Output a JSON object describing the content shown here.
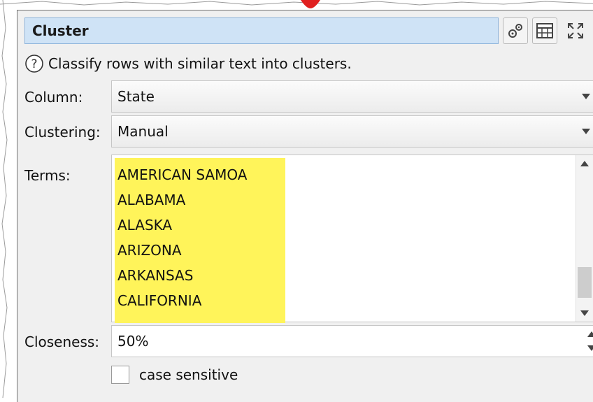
{
  "panel": {
    "title": "Cluster",
    "help_text": "Classify rows with similar text into clusters.",
    "icons": {
      "settings": "gears-icon",
      "table": "table-icon",
      "expand": "expand-icon",
      "help": "help-icon"
    }
  },
  "fields": {
    "column": {
      "label": "Column:",
      "value": "State"
    },
    "clustering": {
      "label": "Clustering:",
      "value": "Manual"
    },
    "terms": {
      "label": "Terms:",
      "items": [
        "AMERICAN SAMOA",
        "ALABAMA",
        "ALASKA",
        "ARIZONA",
        "ARKANSAS",
        "CALIFORNIA"
      ]
    },
    "closeness": {
      "label": "Closeness:",
      "value": "50%"
    },
    "case_sensitive": {
      "label": "case sensitive",
      "checked": false
    }
  },
  "colors": {
    "title_bg": "#cfe3f6",
    "highlight": "#fff45a",
    "pointer": "#e02020"
  }
}
